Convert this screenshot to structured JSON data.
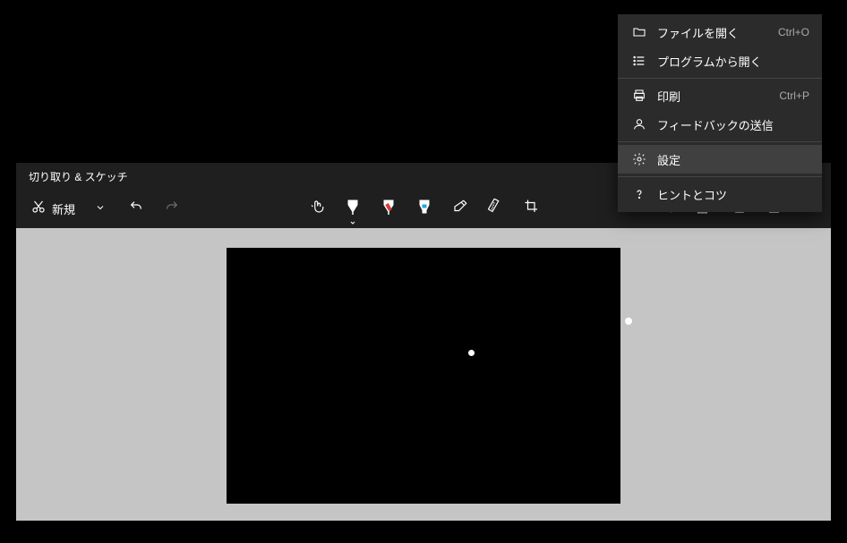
{
  "app": {
    "title": "切り取り & スケッチ"
  },
  "toolbar": {
    "new_label": "新規"
  },
  "menu": {
    "open_file": "ファイルを開く",
    "open_file_shortcut": "Ctrl+O",
    "open_with": "プログラムから開く",
    "print_label": "印刷",
    "print_shortcut": "Ctrl+P",
    "feedback": "フィードバックの送信",
    "settings": "設定",
    "tips": "ヒントとコツ"
  }
}
